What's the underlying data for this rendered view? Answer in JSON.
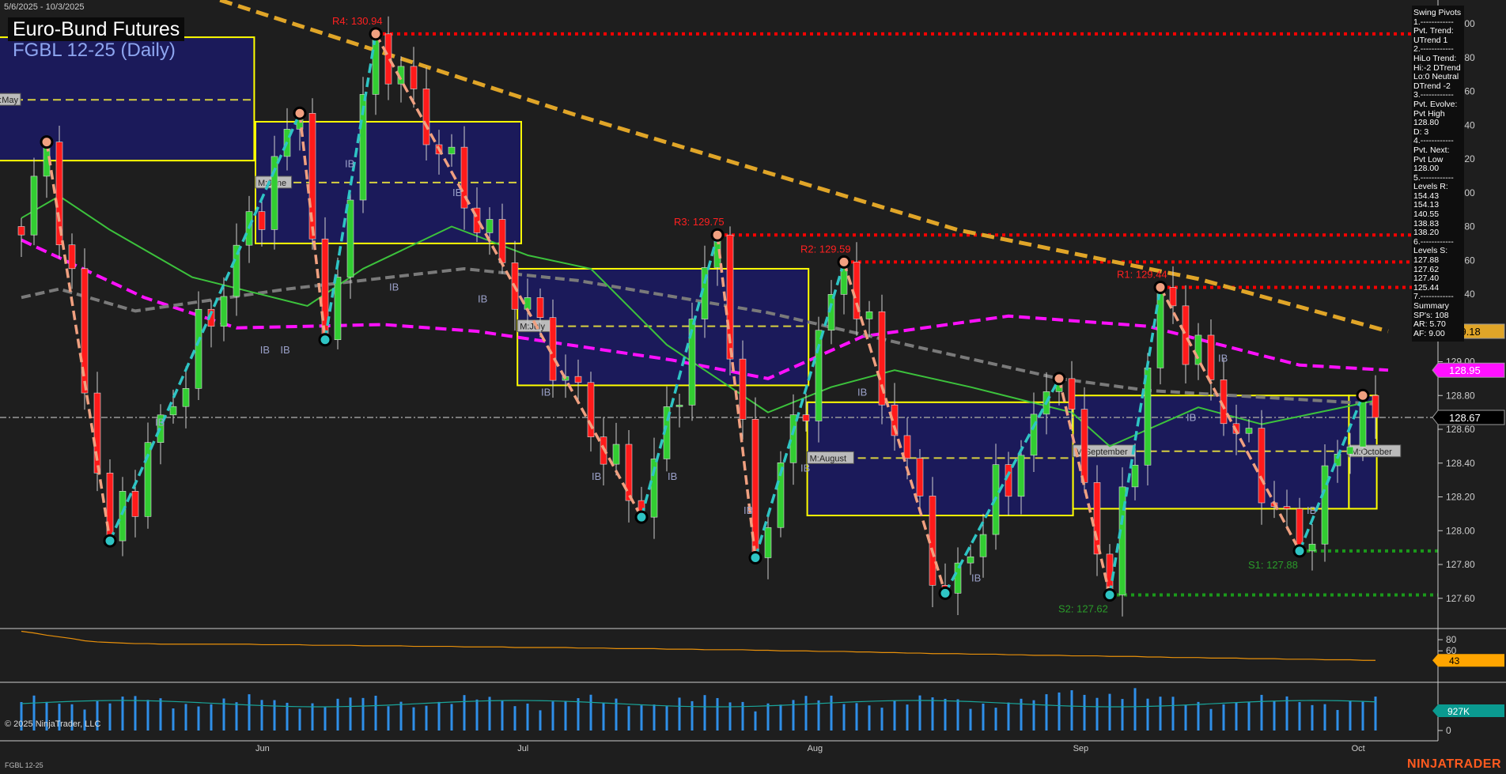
{
  "header": {
    "date_range": "5/6/2025 - 10/3/2025",
    "title": "Euro-Bund Futures",
    "subtitle": "FGBL 12-25 (Daily)"
  },
  "swing_panel": {
    "lines": [
      "Swing Pivots",
      "1.------------",
      "Pvt. Trend:",
      "UTrend 1",
      "2.------------",
      "HiLo Trend:",
      "Hi:-2 DTrend",
      "Lo:0 Neutral",
      "DTrend -2",
      "3.------------",
      "Pvt. Evolve:",
      "Pvt High",
      "128.80",
      "D: 3",
      "4.------------",
      "Pvt. Next:",
      "Pvt Low",
      "128.00",
      "5.------------",
      "Levels R:",
      "154.43",
      "154.13",
      "140.55",
      "138.83",
      "138.20",
      "6.------------",
      "Levels S:",
      "127.88",
      "127.62",
      "127.40",
      "125.44",
      "7.------------",
      "Summary",
      "SP's: 108",
      "AR: 5.70",
      "AF: 9.00"
    ]
  },
  "footer": {
    "copyright": "© 2025 NinjaTrader, LLC",
    "symbol": "FGBL 12-25",
    "brand": "NINJATRADER"
  },
  "colors": {
    "background": "#1e1e1e",
    "up_candle": "#32cd32",
    "down_candle": "#ff1a1a",
    "long_ma": "#e0a528",
    "magenta_ma": "#ff10ff",
    "gray_ma": "#808080",
    "green_ma": "#3cc23c",
    "resistance": "#ff0000",
    "support": "#1a8a1a",
    "month_box": "#ffff00",
    "month_fill": "#1b1a5a"
  },
  "chart_data": {
    "type": "candlestick",
    "bars": 108,
    "ylim": [
      127.5,
      131.14
    ],
    "y_ticks": [
      "127.60",
      "127.80",
      "128.00",
      "128.20",
      "128.40",
      "128.60",
      "128.80",
      "129.00",
      "129.20",
      "129.40",
      "129.60",
      "129.80",
      "130.00",
      "130.20",
      "130.40",
      "130.60",
      "130.80",
      "131.00"
    ],
    "x_labels": [
      {
        "label": "Jun",
        "bar": 19
      },
      {
        "label": "Jul",
        "bar": 39.7
      },
      {
        "label": "Aug",
        "bar": 62.6
      },
      {
        "label": "Sep",
        "bar": 83.6
      },
      {
        "label": "Oct",
        "bar": 105.6
      }
    ],
    "swing_pivots": [
      {
        "bar": 0,
        "price": 129.75,
        "type": "start"
      },
      {
        "bar": 2,
        "price": 130.3,
        "type": "high"
      },
      {
        "bar": 7,
        "price": 127.94,
        "type": "low"
      },
      {
        "bar": 22,
        "price": 130.47,
        "type": "high"
      },
      {
        "bar": 24,
        "price": 129.13,
        "type": "low"
      },
      {
        "bar": 28,
        "price": 130.94,
        "type": "high",
        "label": "R4: 130.94"
      },
      {
        "bar": 49,
        "price": 128.08,
        "type": "low"
      },
      {
        "bar": 55,
        "price": 129.75,
        "type": "high",
        "label": "R3: 129.75"
      },
      {
        "bar": 58,
        "price": 127.84,
        "type": "low"
      },
      {
        "bar": 65,
        "price": 129.59,
        "type": "high",
        "label": "R2: 129.59"
      },
      {
        "bar": 73,
        "price": 127.63,
        "type": "low"
      },
      {
        "bar": 82,
        "price": 128.9,
        "type": "high"
      },
      {
        "bar": 86,
        "price": 127.62,
        "type": "low",
        "label": "S2: 127.62"
      },
      {
        "bar": 90,
        "price": 129.44,
        "type": "high",
        "label": "R1: 129.44"
      },
      {
        "bar": 101,
        "price": 127.88,
        "type": "low",
        "label": "S1: 127.88"
      },
      {
        "bar": 106,
        "price": 128.8,
        "type": "high"
      },
      {
        "bar": 107,
        "price": 128.67,
        "type": "last"
      }
    ],
    "levels": [
      {
        "name": "R4",
        "price": 130.94,
        "from": 28,
        "kind": "resistance"
      },
      {
        "name": "R3",
        "price": 129.75,
        "from": 55,
        "kind": "resistance"
      },
      {
        "name": "R2",
        "price": 129.59,
        "from": 65,
        "kind": "resistance"
      },
      {
        "name": "R1",
        "price": 129.44,
        "from": 90,
        "kind": "resistance"
      },
      {
        "name": "S1",
        "price": 127.88,
        "from": 101,
        "kind": "support"
      },
      {
        "name": "S2",
        "price": 127.62,
        "from": 86,
        "kind": "support"
      }
    ],
    "month_ranges": [
      {
        "label": "M:May",
        "from": -2,
        "to": 17.9,
        "high": 130.92,
        "low": 130.19,
        "mid": 130.55
      },
      {
        "label": "M:June",
        "from": 19,
        "to": 39,
        "high": 130.42,
        "low": 129.7,
        "mid": 130.06
      },
      {
        "label": "M:July",
        "from": 39.7,
        "to": 61.7,
        "high": 129.55,
        "low": 128.86,
        "mid": 129.21
      },
      {
        "label": "M:August",
        "from": 62.6,
        "to": 82.6,
        "high": 128.76,
        "low": 128.09,
        "mid": 128.43
      },
      {
        "label": "M:September",
        "from": 83.6,
        "to": 104.4,
        "high": 128.8,
        "low": 128.13,
        "mid": 128.47
      },
      {
        "label": "M:October",
        "from": 105.4,
        "to": 106.6,
        "high": 128.8,
        "low": 128.13,
        "mid": 128.47
      }
    ],
    "moving_averages": [
      {
        "name": "long",
        "color": "#e0a528",
        "dash": "16 8",
        "width": 5,
        "points": [
          [
            15.7,
            131.14
          ],
          [
            43.8,
            130.46
          ],
          [
            74,
            129.78
          ],
          [
            93,
            129.49
          ],
          [
            108,
            129.18
          ]
        ]
      },
      {
        "name": "magenta",
        "color": "#ff10ff",
        "dash": "14 7",
        "width": 4,
        "points": [
          [
            0,
            129.72
          ],
          [
            9.7,
            129.38
          ],
          [
            17,
            129.2
          ],
          [
            28.6,
            129.22
          ],
          [
            36,
            129.18
          ],
          [
            51.4,
            129.01
          ],
          [
            59,
            128.9
          ],
          [
            66.5,
            129.15
          ],
          [
            78,
            129.27
          ],
          [
            89,
            129.21
          ],
          [
            101,
            128.98
          ],
          [
            108,
            128.95
          ]
        ]
      },
      {
        "name": "gray",
        "color": "#7a7a7a",
        "dash": "12 6",
        "width": 4,
        "points": [
          [
            0,
            129.38
          ],
          [
            3,
            129.43
          ],
          [
            9,
            129.3
          ],
          [
            21,
            129.43
          ],
          [
            35,
            129.55
          ],
          [
            44,
            129.48
          ],
          [
            59,
            129.29
          ],
          [
            70,
            129.1
          ],
          [
            82,
            128.9
          ],
          [
            89,
            128.83
          ],
          [
            107,
            128.75
          ]
        ]
      },
      {
        "name": "green",
        "color": "#3cc23c",
        "dash": "",
        "width": 2,
        "points": [
          [
            0,
            129.85
          ],
          [
            3,
            129.98
          ],
          [
            7,
            129.78
          ],
          [
            13.5,
            129.5
          ],
          [
            22.6,
            129.33
          ],
          [
            27,
            129.55
          ],
          [
            34,
            129.8
          ],
          [
            40,
            129.63
          ],
          [
            45,
            129.55
          ],
          [
            51,
            129.1
          ],
          [
            59,
            128.7
          ],
          [
            64,
            128.85
          ],
          [
            69,
            128.95
          ],
          [
            75,
            128.85
          ],
          [
            83,
            128.7
          ],
          [
            86,
            128.5
          ],
          [
            93,
            128.73
          ],
          [
            98,
            128.63
          ],
          [
            107,
            128.77
          ]
        ]
      }
    ],
    "last_price": 128.67,
    "price_markers": [
      {
        "value": "129.18",
        "price": 129.18,
        "bg": "#e0a528",
        "fg": "#000"
      },
      {
        "value": "128.95",
        "price": 128.95,
        "bg": "#ff10ff",
        "fg": "#fff"
      },
      {
        "value": "128.67",
        "price": 128.67,
        "bg": "#000000",
        "fg": "#fff"
      }
    ],
    "ib_labels": [
      {
        "bar": 11,
        "price": 128.62
      },
      {
        "bar": 19.3,
        "price": 129.05
      },
      {
        "bar": 20.9,
        "price": 129.05
      },
      {
        "bar": 26,
        "price": 130.15
      },
      {
        "bar": 29.5,
        "price": 129.42
      },
      {
        "bar": 34.5,
        "price": 129.98
      },
      {
        "bar": 36.5,
        "price": 129.35
      },
      {
        "bar": 41.5,
        "price": 128.8
      },
      {
        "bar": 45.5,
        "price": 128.3
      },
      {
        "bar": 51.5,
        "price": 128.3
      },
      {
        "bar": 57.5,
        "price": 128.1
      },
      {
        "bar": 62,
        "price": 128.35
      },
      {
        "bar": 66.5,
        "price": 128.8
      },
      {
        "bar": 75.5,
        "price": 127.7
      },
      {
        "bar": 92.5,
        "price": 128.65
      },
      {
        "bar": 95,
        "price": 129.0
      },
      {
        "bar": 102,
        "price": 128.1
      }
    ],
    "oscillator": {
      "last": "43",
      "ticks": [
        "80",
        "60"
      ],
      "values": [
        95,
        92,
        88,
        85,
        82,
        78,
        76,
        75,
        74,
        73,
        73,
        72,
        72,
        72,
        72,
        72,
        72,
        72,
        72,
        71,
        71,
        71,
        71,
        70,
        70,
        70,
        70,
        69,
        69,
        69,
        69,
        68,
        68,
        68,
        68,
        67,
        67,
        67,
        67,
        66,
        66,
        66,
        66,
        66,
        65,
        65,
        65,
        64,
        64,
        64,
        64,
        63,
        63,
        63,
        62,
        62,
        62,
        62,
        61,
        61,
        60,
        60,
        60,
        59,
        59,
        59,
        58,
        58,
        57,
        57,
        56,
        56,
        55,
        55,
        55,
        54,
        54,
        54,
        53,
        53,
        52,
        52,
        52,
        51,
        51,
        51,
        50,
        50,
        50,
        49,
        49,
        48,
        48,
        48,
        47,
        47,
        47,
        46,
        46,
        46,
        45,
        45,
        45,
        44,
        44,
        44,
        43,
        43
      ]
    },
    "volume": {
      "last": "927K",
      "ticks": [
        "0"
      ]
    }
  }
}
